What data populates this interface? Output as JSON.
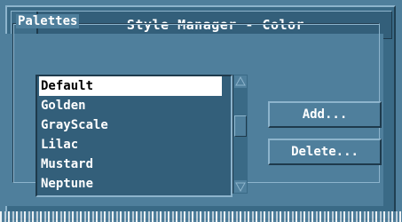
{
  "window": {
    "title": "Style Manager - Color"
  },
  "palettes": {
    "label": "Palettes",
    "items": [
      {
        "label": "Default",
        "selected": true
      },
      {
        "label": "Golden",
        "selected": false
      },
      {
        "label": "GrayScale",
        "selected": false
      },
      {
        "label": "Lilac",
        "selected": false
      },
      {
        "label": "Mustard",
        "selected": false
      },
      {
        "label": "Neptune",
        "selected": false
      }
    ]
  },
  "buttons": {
    "add": "Add...",
    "delete": "Delete..."
  },
  "colors": {
    "background": "#4f7f9c",
    "titlebar": "#335f7a",
    "text": "#ffffff",
    "selected_bg": "#ffffff",
    "selected_text": "#000000"
  }
}
